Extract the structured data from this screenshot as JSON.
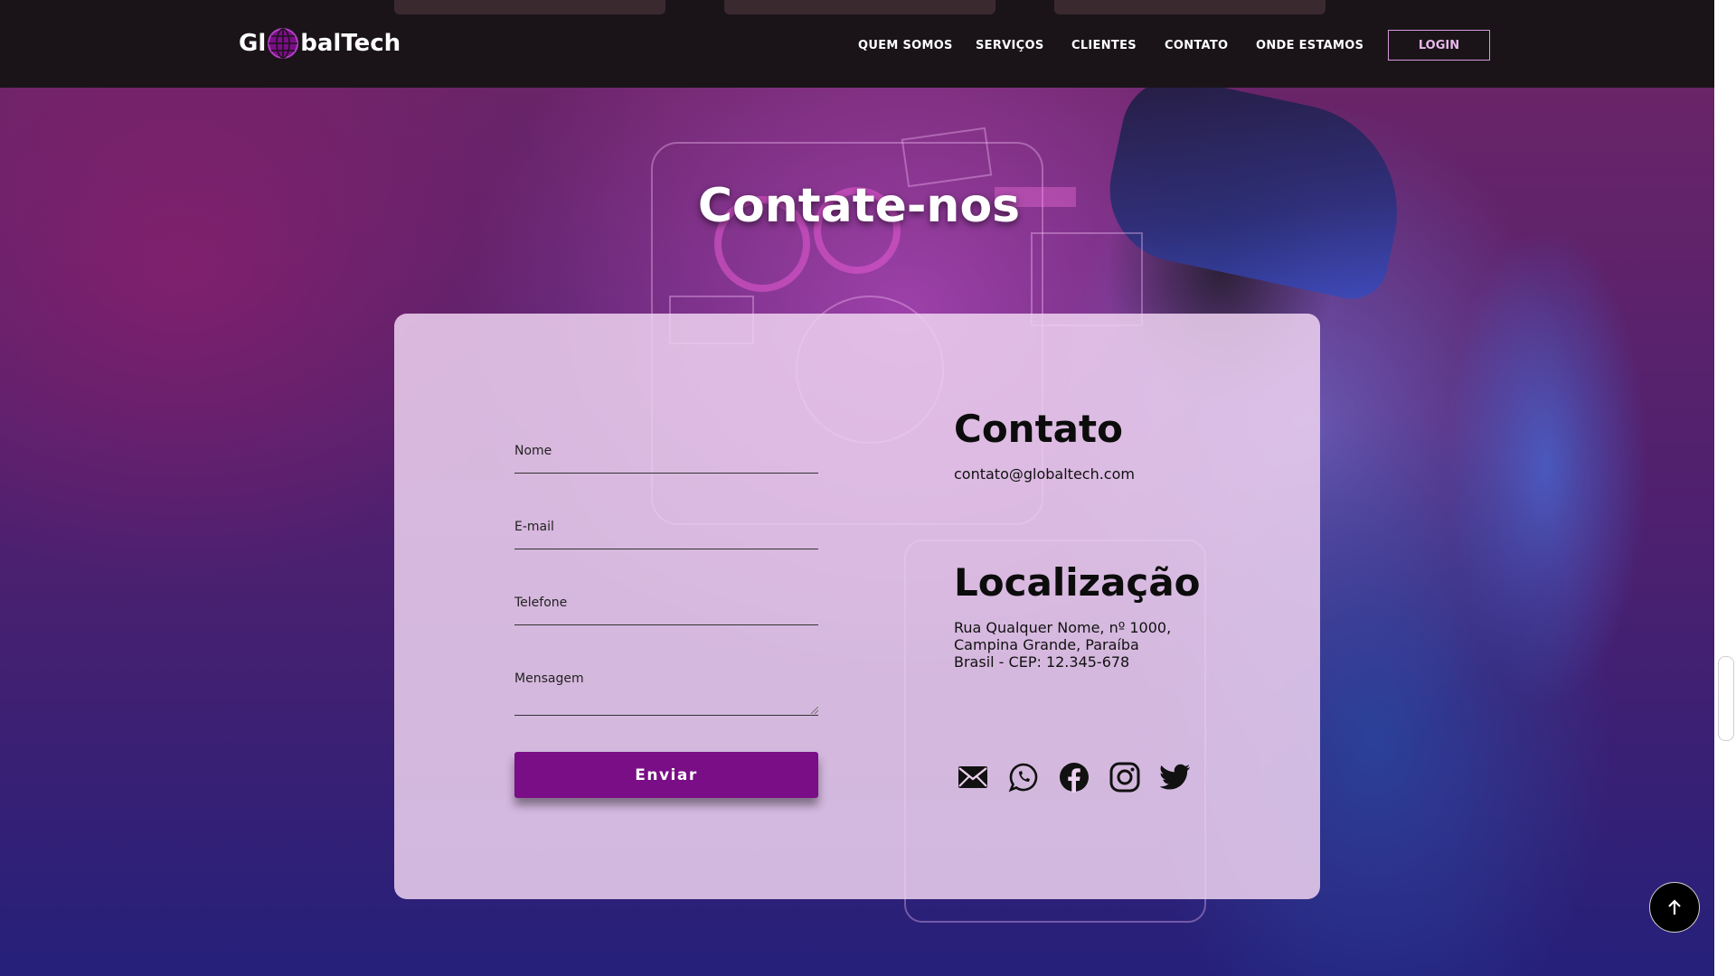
{
  "header": {
    "logo_prefix": "Gl",
    "logo_suffix": "balTech",
    "nav": [
      "QUEM SOMOS",
      "SERVIÇOS",
      "CLIENTES",
      "CONTATO",
      "ONDE ESTAMOS"
    ],
    "login_label": "LOGIN"
  },
  "hero": {
    "title": "Contate-nos"
  },
  "form": {
    "name_label": "Nome",
    "email_label": "E-mail",
    "phone_label": "Telefone",
    "message_label": "Mensagem",
    "submit_label": "Enviar"
  },
  "contact": {
    "heading": "Contato",
    "email": "contato@globaltech.com"
  },
  "location": {
    "heading": "Localização",
    "address_lines": [
      "Rua Qualquer Nome, nº 1000,",
      "Campina Grande, Paraíba",
      "Brasil - CEP: 12.345-678"
    ]
  },
  "social_icons": [
    "mail-icon",
    "whatsapp-icon",
    "facebook-icon",
    "instagram-icon",
    "twitter-icon"
  ],
  "colors": {
    "accent": "#7a0e86",
    "header_bg": "#1a1419",
    "card_bg": "#eed2f0",
    "login_border": "#d59ad8"
  }
}
